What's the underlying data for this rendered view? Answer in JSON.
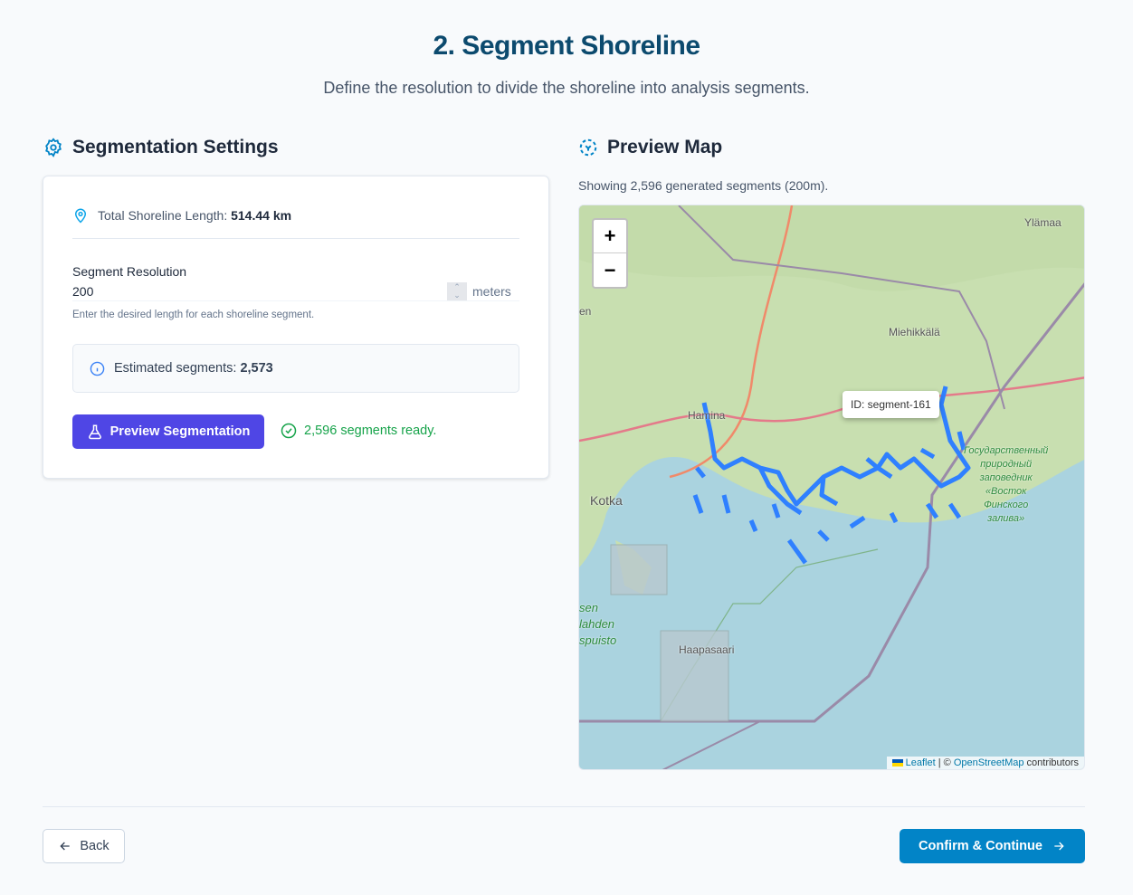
{
  "header": {
    "title": "2. Segment Shoreline",
    "subtitle": "Define the resolution to divide the shoreline into analysis segments."
  },
  "settings": {
    "heading": "Segmentation Settings",
    "shoreline_label": "Total Shoreline Length:",
    "shoreline_value": "514.44 km",
    "resolution_label": "Segment Resolution",
    "resolution_value": "200",
    "resolution_unit": "meters",
    "resolution_help": "Enter the desired length for each shoreline segment.",
    "estimate_label": "Estimated segments:",
    "estimate_value": "2,573",
    "preview_button": "Preview Segmentation",
    "ready_status": "2,596 segments ready."
  },
  "map": {
    "heading": "Preview Map",
    "caption": "Showing 2,596 generated segments (200m).",
    "zoom_in": "+",
    "zoom_out": "−",
    "tooltip": "ID: segment-161",
    "places": [
      "Ylämaa",
      "Miehikkälä",
      "Hamina",
      "Kotka",
      "Haapasaari",
      "en",
      "sen",
      "lahden",
      "spuisto"
    ],
    "reserve_label": [
      "Государственный",
      "природный",
      "заповедник",
      "«Восток",
      "Финского",
      "залива»"
    ],
    "attribution": {
      "leaflet": "Leaflet",
      "sep": " | © ",
      "osm": "OpenStreetMap",
      "suffix": " contributors"
    }
  },
  "footer": {
    "back": "Back",
    "confirm": "Confirm & Continue"
  },
  "colors": {
    "accent": "#0284c7",
    "primary": "#4f46e5",
    "success": "#16a34a",
    "segment": "#2f80ff"
  }
}
